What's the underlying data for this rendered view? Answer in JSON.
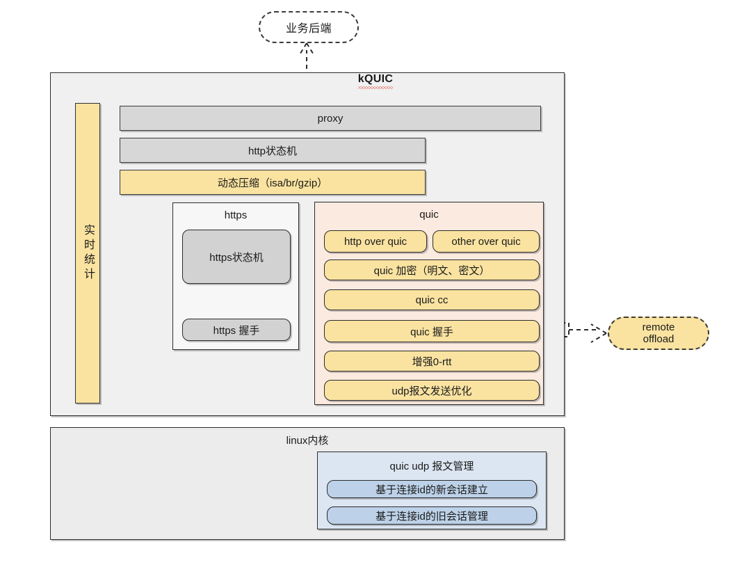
{
  "diagram": {
    "backend_bubble": {
      "label": "业务后端"
    },
    "kquic": {
      "title": "kQUIC",
      "stats_bar": {
        "label": "实时统计"
      },
      "bars": [
        {
          "id": "proxy",
          "label": "proxy",
          "color": "#d7d7d7"
        },
        {
          "id": "http-state-machine",
          "label": "http状态机",
          "color": "#d7d7d7"
        },
        {
          "id": "dynamic-compression",
          "label": "动态压缩（isa/br/gzip）",
          "color": "#fae3a0"
        }
      ],
      "https_group": {
        "title": "https",
        "items": [
          {
            "id": "https-state-machine",
            "label": "https状态机",
            "color": "#d2d2d2"
          },
          {
            "id": "https-handshake",
            "label": "https 握手",
            "color": "#d2d2d2"
          }
        ]
      },
      "quic_group": {
        "title": "quic",
        "background": "#faeae0",
        "items": [
          {
            "id": "http-over-quic",
            "label": "http over quic",
            "color": "#fae3a0"
          },
          {
            "id": "other-over-quic",
            "label": "other over quic",
            "color": "#fae3a0"
          },
          {
            "id": "quic-encryption",
            "label": "quic 加密（明文、密文）",
            "color": "#fae3a0"
          },
          {
            "id": "quic-cc",
            "label": "quic cc",
            "color": "#fae3a0"
          },
          {
            "id": "quic-handshake",
            "label": "quic 握手",
            "color": "#fae3a0"
          },
          {
            "id": "enhanced-0rtt",
            "label": "增强0-rtt",
            "color": "#fae3a0"
          },
          {
            "id": "udp-send-optimization",
            "label": "udp报文发送优化",
            "color": "#fae3a0"
          }
        ]
      }
    },
    "linux_kernel": {
      "title": "linux内核",
      "quic_udp_group": {
        "title": "quic udp 报文管理",
        "background": "#dce6f2",
        "items": [
          {
            "id": "new-session-by-connid",
            "label": "基于连接id的新会话建立",
            "color": "#bdd2e8"
          },
          {
            "id": "old-session-by-connid",
            "label": "基于连接id的旧会话管理",
            "color": "#bdd2e8"
          }
        ]
      }
    },
    "remote_offload_bubble": {
      "line1": "remote",
      "line2": "offload"
    },
    "connectors": [
      {
        "id": "kquic-to-backend",
        "style": "dashed",
        "direction": "up"
      },
      {
        "id": "quic-to-remote-offload",
        "style": "dashed",
        "direction": "right"
      }
    ]
  }
}
